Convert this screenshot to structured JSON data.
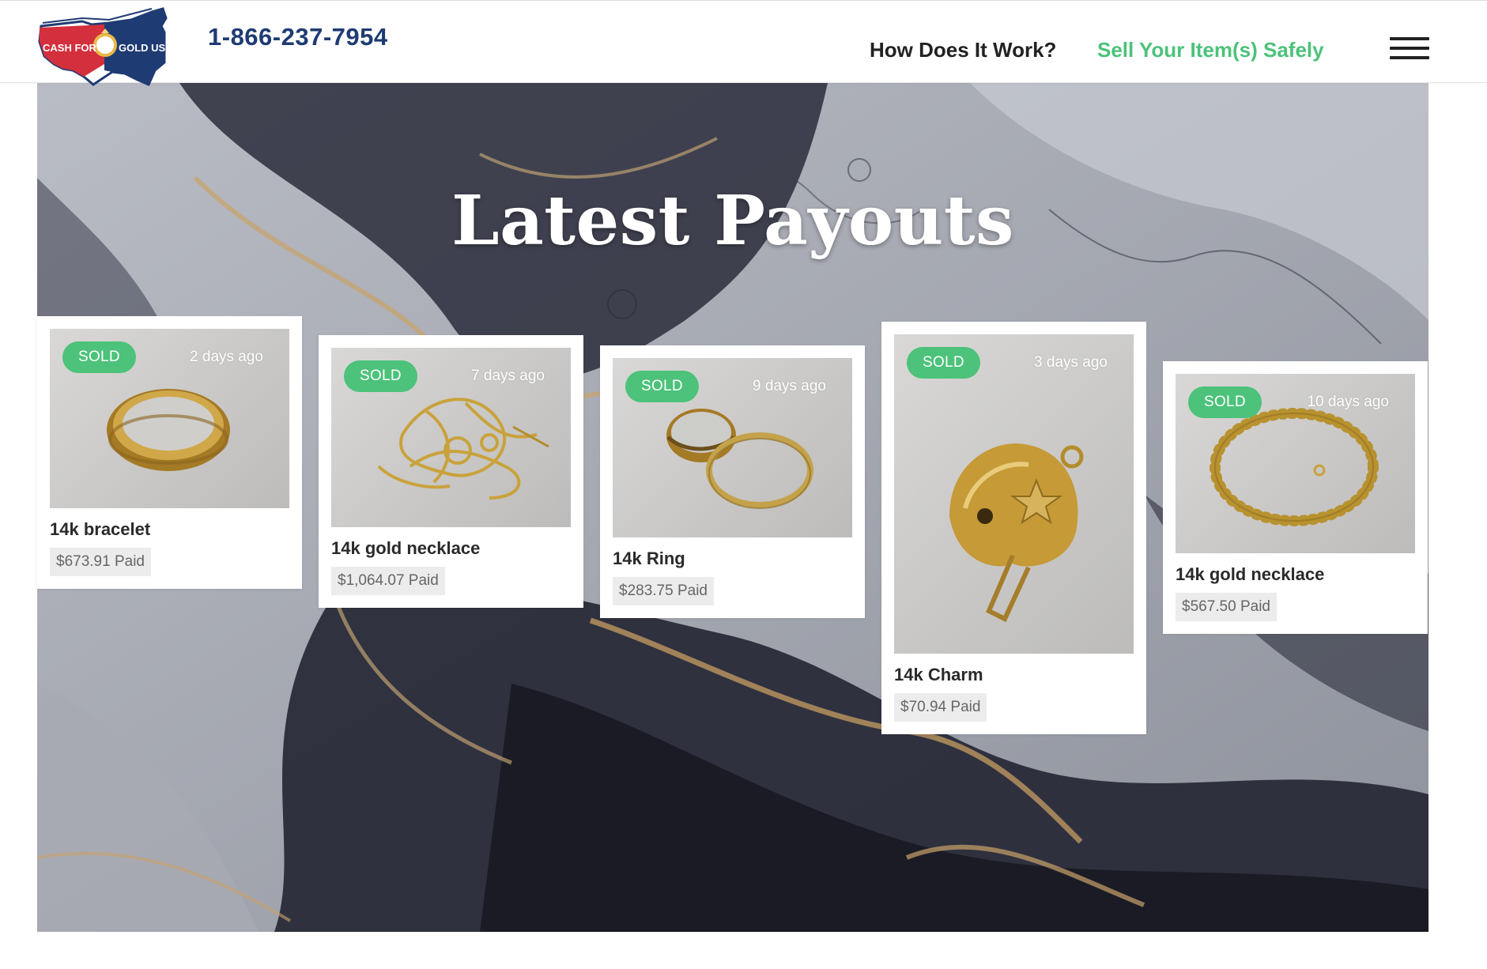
{
  "header": {
    "logo_text_left": "CASH FOR",
    "logo_text_right": "GOLD USA",
    "phone": "1-866-237-7954",
    "nav": {
      "how_it_works": "How Does It Work?",
      "sell_safely": "Sell Your Item(s) Safely"
    },
    "menu_icon": "hamburger-icon"
  },
  "hero": {
    "title": "Latest Payouts"
  },
  "payouts": [
    {
      "badge": "SOLD",
      "time_ago": "2 days ago",
      "title": "14k bracelet",
      "price": "$673.91 Paid",
      "image": "gold-band-ring"
    },
    {
      "badge": "SOLD",
      "time_ago": "7 days ago",
      "title": "14k gold necklace",
      "price": "$1,064.07 Paid",
      "image": "tangled-gold-chains"
    },
    {
      "badge": "SOLD",
      "time_ago": "9 days ago",
      "title": "14k Ring",
      "price": "$283.75 Paid",
      "image": "two-gold-rings"
    },
    {
      "badge": "SOLD",
      "time_ago": "3 days ago",
      "title": "14k Charm",
      "price": "$70.94 Paid",
      "image": "football-helmet-charm"
    },
    {
      "badge": "SOLD",
      "time_ago": "10 days ago",
      "title": "14k gold necklace",
      "price": "$567.50 Paid",
      "image": "gold-bead-necklace"
    }
  ],
  "colors": {
    "brand_navy": "#1f3b73",
    "brand_red": "#d32f3c",
    "accent_green": "#4cc27a",
    "text_dark": "#222222"
  }
}
